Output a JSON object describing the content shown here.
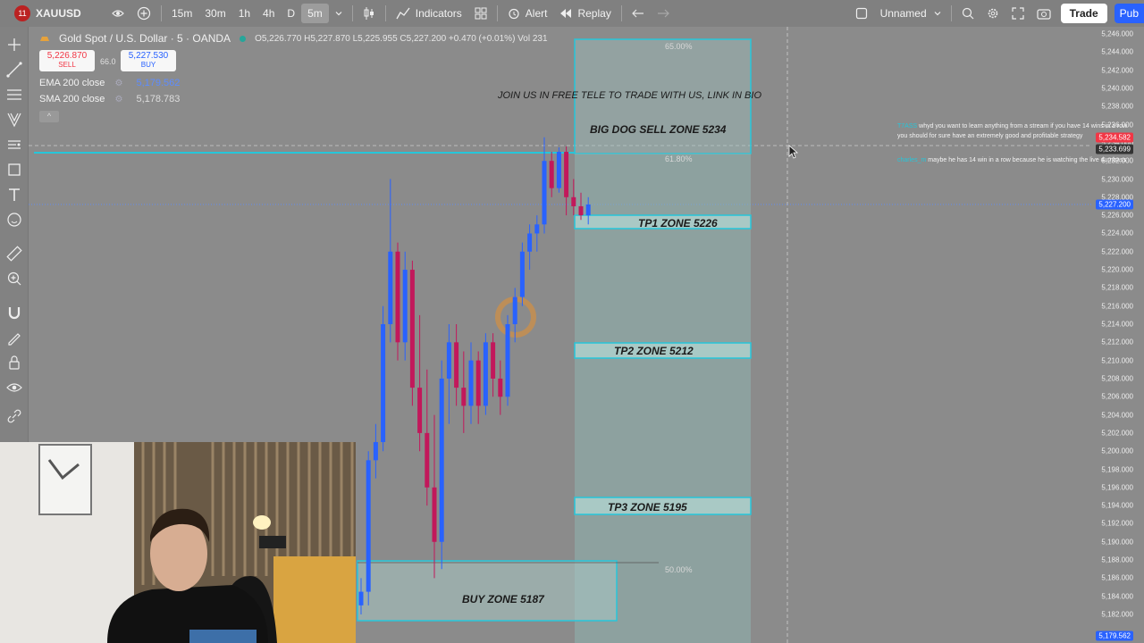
{
  "toolbar": {
    "record_badge": "11",
    "symbol": "XAUUSD",
    "intervals": [
      "15m",
      "30m",
      "1h",
      "4h",
      "D",
      "5m"
    ],
    "active_interval": "5m",
    "indicators_label": "Indicators",
    "alert_label": "Alert",
    "replay_label": "Replay",
    "layout_name": "Unnamed",
    "trade_label": "Trade",
    "publish_label": "Pub"
  },
  "legend": {
    "title": "Gold Spot / U.S. Dollar · 5 · OANDA",
    "ohlc": "O5,226.770 H5,227.870 L5,225.955 C5,227.200 +0.470 (+0.01%) Vol 231",
    "sell_price": "5,226.870",
    "sell_label": "SELL",
    "spread": "66.0",
    "buy_price": "5,227.530",
    "buy_label": "BUY",
    "collapse_icon": "^",
    "indicators": [
      {
        "name": "EMA 200 close",
        "value": "5,179.562"
      },
      {
        "name": "SMA 200 close",
        "value": "5,178.783"
      }
    ]
  },
  "chart": {
    "promo_text": "JOIN US IN FREE TELE TO TRADE WITH US, LINK IN BIO",
    "zones": {
      "sell": "BIG DOG SELL ZONE 5234",
      "tp1": "TP1 ZONE 5226",
      "tp2": "TP2 ZONE 5212",
      "tp3": "TP3 ZONE 5195",
      "buy": "BUY ZONE 5187"
    },
    "fib_levels": {
      "top": "65.00%",
      "mid": "61.80%",
      "half": "50.00%"
    }
  },
  "price_axis": {
    "ticks": [
      "5,246.000",
      "5,244.000",
      "5,242.000",
      "5,240.000",
      "5,238.000",
      "5,236.000",
      "5,234.000",
      "5,232.000",
      "5,230.000",
      "5,228.000",
      "5,226.000",
      "5,224.000",
      "5,222.000",
      "5,220.000",
      "5,218.000",
      "5,216.000",
      "5,214.000",
      "5,212.000",
      "5,210.000",
      "5,208.000",
      "5,206.000",
      "5,204.000",
      "5,202.000",
      "5,200.000",
      "5,198.000",
      "5,196.000",
      "5,194.000",
      "5,192.000",
      "5,190.000",
      "5,188.000",
      "5,186.000",
      "5,184.000",
      "5,182.000"
    ],
    "tag_high": "5,234.582",
    "tag_cross": "5,233.699",
    "tag_last": "5,227.200",
    "tag_bottom": "5,179.562"
  },
  "chat": [
    {
      "user": "T7ASS",
      "text": "whyd you want to learn anything from a stream if you have 14 wins in a row you should for sure have an extremely good and profitable strategy"
    },
    {
      "user": "charles_m",
      "text": "maybe he has 14 win in a row because he is watching the live dumbass"
    }
  ],
  "colors": {
    "bull": "#2962ff",
    "bear": "#c2185b",
    "zone_border": "#26c6da",
    "zone_fill": "#8fb8b3",
    "accent": "#2962ff",
    "tag_red": "#f23645"
  },
  "candles": [
    {
      "o": 5183.0,
      "h": 5186.0,
      "l": 5182.0,
      "c": 5184.5
    },
    {
      "o": 5184.5,
      "h": 5200.0,
      "l": 5183.0,
      "c": 5199.0
    },
    {
      "o": 5199.0,
      "h": 5203.0,
      "l": 5197.0,
      "c": 5201.0
    },
    {
      "o": 5201.0,
      "h": 5216.0,
      "l": 5200.0,
      "c": 5214.0
    },
    {
      "o": 5214.0,
      "h": 5230.0,
      "l": 5212.0,
      "c": 5222.0
    },
    {
      "o": 5222.0,
      "h": 5223.0,
      "l": 5210.0,
      "c": 5212.0
    },
    {
      "o": 5212.0,
      "h": 5222.0,
      "l": 5210.0,
      "c": 5220.0
    },
    {
      "o": 5220.0,
      "h": 5221.0,
      "l": 5205.0,
      "c": 5207.0
    },
    {
      "o": 5207.0,
      "h": 5215.0,
      "l": 5200.0,
      "c": 5202.0
    },
    {
      "o": 5202.0,
      "h": 5209.0,
      "l": 5194.0,
      "c": 5196.0
    },
    {
      "o": 5196.0,
      "h": 5204.0,
      "l": 5186.0,
      "c": 5190.0
    },
    {
      "o": 5190.0,
      "h": 5210.0,
      "l": 5187.0,
      "c": 5208.0
    },
    {
      "o": 5208.0,
      "h": 5214.0,
      "l": 5203.0,
      "c": 5212.0
    },
    {
      "o": 5212.0,
      "h": 5214.0,
      "l": 5205.0,
      "c": 5207.0
    },
    {
      "o": 5207.0,
      "h": 5211.0,
      "l": 5202.0,
      "c": 5205.0
    },
    {
      "o": 5205.0,
      "h": 5212.0,
      "l": 5203.0,
      "c": 5210.0
    },
    {
      "o": 5210.0,
      "h": 5211.0,
      "l": 5203.0,
      "c": 5205.0
    },
    {
      "o": 5205.0,
      "h": 5213.0,
      "l": 5204.0,
      "c": 5212.0
    },
    {
      "o": 5212.0,
      "h": 5213.0,
      "l": 5206.0,
      "c": 5208.0
    },
    {
      "o": 5208.0,
      "h": 5210.0,
      "l": 5204.0,
      "c": 5206.0
    },
    {
      "o": 5206.0,
      "h": 5215.0,
      "l": 5205.0,
      "c": 5214.0
    },
    {
      "o": 5214.0,
      "h": 5218.0,
      "l": 5212.0,
      "c": 5217.0
    },
    {
      "o": 5217.0,
      "h": 5223.0,
      "l": 5216.0,
      "c": 5222.0
    },
    {
      "o": 5222.0,
      "h": 5225.0,
      "l": 5220.0,
      "c": 5224.0
    },
    {
      "o": 5224.0,
      "h": 5226.0,
      "l": 5222.0,
      "c": 5225.0
    },
    {
      "o": 5225.0,
      "h": 5234.6,
      "l": 5224.0,
      "c": 5232.0
    },
    {
      "o": 5232.0,
      "h": 5233.0,
      "l": 5228.0,
      "c": 5229.0
    },
    {
      "o": 5229.0,
      "h": 5233.5,
      "l": 5228.5,
      "c": 5233.0
    },
    {
      "o": 5233.0,
      "h": 5233.6,
      "l": 5226.0,
      "c": 5228.0
    },
    {
      "o": 5228.0,
      "h": 5230.0,
      "l": 5226.0,
      "c": 5227.0
    },
    {
      "o": 5227.0,
      "h": 5228.5,
      "l": 5225.5,
      "c": 5226.0
    },
    {
      "o": 5226.0,
      "h": 5228.0,
      "l": 5225.0,
      "c": 5227.2
    }
  ]
}
